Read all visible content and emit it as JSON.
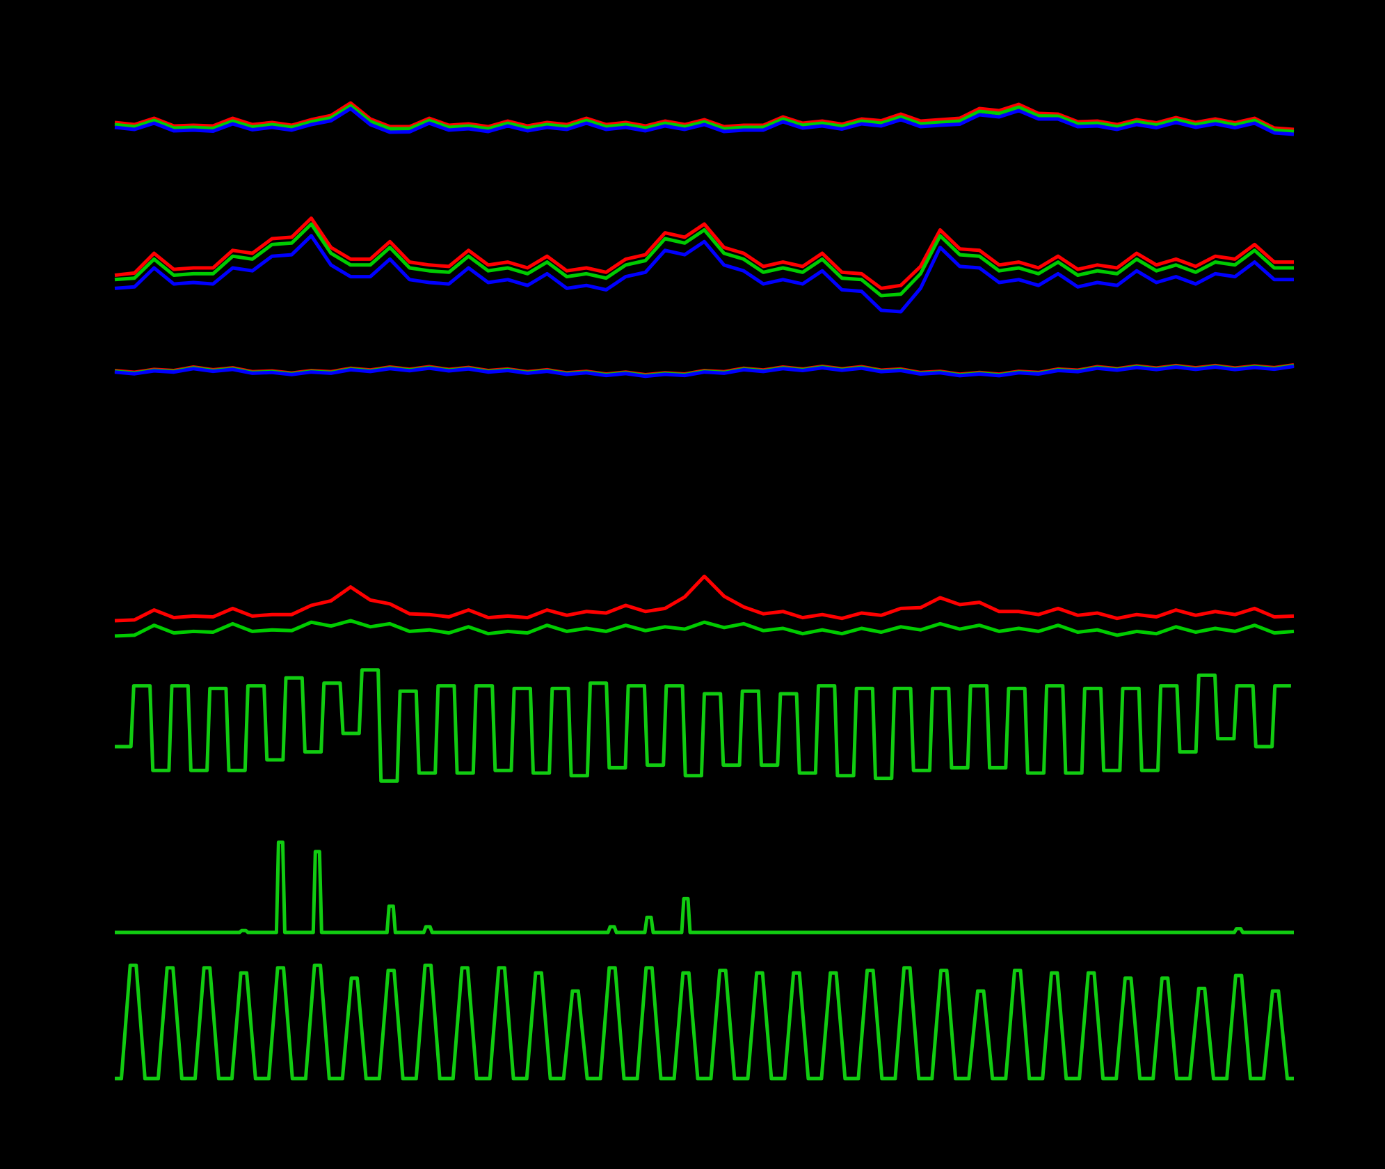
{
  "chart_data": [
    {
      "type": "line",
      "x": {
        "start": 0,
        "step": 1,
        "count": 31
      },
      "ylim": [
        0,
        10
      ],
      "grid": false,
      "legend": "none",
      "series": [
        {
          "color": "#ff0000",
          "values": [
            5.4,
            6.0,
            5.0,
            6.0,
            5.4,
            5.8,
            8.2,
            4.8,
            6.0,
            5.2,
            5.6,
            5.4,
            6.0,
            5.4,
            5.6,
            5.8,
            5.0,
            6.2,
            5.6,
            5.9,
            6.6,
            5.8,
            7.4,
            8.0,
            6.6,
            5.6,
            5.8,
            6.1,
            5.9,
            6.0,
            4.4
          ]
        },
        {
          "color": "#00cc00",
          "values": [
            5.1,
            5.7,
            4.7,
            5.6,
            5.1,
            5.5,
            7.8,
            4.5,
            5.7,
            4.9,
            5.3,
            5.1,
            5.7,
            5.1,
            5.3,
            5.5,
            4.7,
            5.9,
            5.3,
            5.6,
            6.2,
            5.4,
            7.0,
            7.6,
            6.3,
            5.3,
            5.5,
            5.8,
            5.6,
            5.7,
            4.1
          ]
        },
        {
          "color": "#0000ff",
          "values": [
            4.7,
            5.3,
            4.3,
            5.2,
            4.7,
            5.1,
            7.4,
            4.0,
            5.3,
            4.5,
            4.9,
            4.7,
            5.3,
            4.7,
            4.9,
            5.1,
            4.3,
            5.5,
            4.9,
            5.2,
            5.8,
            5.0,
            6.5,
            7.1,
            5.9,
            4.9,
            5.1,
            5.4,
            5.2,
            5.3,
            3.7
          ]
        }
      ]
    },
    {
      "type": "line",
      "x": {
        "start": 0,
        "step": 1,
        "count": 31
      },
      "ylim": [
        0,
        10
      ],
      "grid": false,
      "legend": "none",
      "series": [
        {
          "color": "#ff0000",
          "values": [
            4.5,
            6.0,
            5.0,
            6.2,
            7.0,
            8.4,
            5.6,
            6.8,
            5.2,
            6.2,
            5.4,
            5.8,
            5.0,
            5.6,
            7.4,
            8.0,
            6.0,
            5.4,
            6.0,
            4.6,
            3.8,
            7.6,
            6.2,
            5.4,
            5.8,
            5.2,
            6.0,
            5.6,
            5.8,
            6.6,
            5.4
          ]
        },
        {
          "color": "#00cc00",
          "values": [
            4.2,
            5.6,
            4.6,
            5.8,
            6.6,
            8.0,
            5.2,
            6.4,
            4.8,
            5.8,
            5.0,
            5.4,
            4.6,
            5.2,
            7.0,
            7.6,
            5.6,
            5.0,
            5.6,
            4.2,
            3.2,
            7.2,
            5.8,
            5.0,
            5.4,
            4.8,
            5.6,
            5.2,
            5.4,
            6.2,
            5.0
          ]
        },
        {
          "color": "#0000ff",
          "values": [
            3.6,
            5.0,
            4.0,
            5.0,
            5.8,
            7.2,
            4.4,
            5.6,
            4.0,
            5.0,
            4.2,
            4.6,
            3.8,
            4.4,
            6.2,
            6.8,
            4.8,
            4.2,
            4.8,
            3.4,
            2.0,
            6.4,
            5.0,
            4.2,
            4.6,
            4.0,
            4.8,
            4.4,
            4.6,
            5.4,
            4.2
          ]
        }
      ]
    },
    {
      "type": "line",
      "x": {
        "start": 0,
        "step": 1,
        "count": 31
      },
      "ylim": [
        0,
        10
      ],
      "grid": false,
      "legend": "none",
      "series": [
        {
          "color": "#ff0000",
          "values": [
            5.0,
            5.3,
            5.9,
            5.7,
            4.9,
            5.0,
            5.6,
            5.9,
            6.0,
            5.8,
            5.4,
            5.2,
            4.8,
            4.6,
            4.4,
            5.0,
            5.6,
            5.9,
            6.1,
            6.0,
            5.4,
            4.8,
            4.5,
            4.8,
            5.4,
            6.0,
            6.2,
            6.3,
            6.3,
            6.2,
            6.5
          ]
        },
        {
          "color": "#00cc00",
          "values": [
            4.8,
            5.1,
            5.7,
            5.5,
            4.7,
            4.8,
            5.4,
            5.7,
            5.8,
            5.6,
            5.2,
            5.0,
            4.6,
            4.4,
            4.2,
            4.8,
            5.4,
            5.7,
            5.9,
            5.8,
            5.2,
            4.6,
            4.3,
            4.6,
            5.2,
            5.8,
            6.0,
            6.1,
            6.1,
            6.0,
            6.3
          ]
        },
        {
          "color": "#0000ff",
          "values": [
            4.6,
            4.9,
            5.5,
            5.3,
            4.5,
            4.6,
            5.2,
            5.5,
            5.6,
            5.4,
            5.0,
            4.8,
            4.4,
            4.2,
            4.0,
            4.6,
            5.2,
            5.5,
            5.7,
            5.6,
            5.0,
            4.4,
            4.1,
            4.4,
            5.0,
            5.6,
            5.8,
            5.9,
            5.9,
            5.8,
            6.1
          ]
        }
      ]
    },
    {
      "type": "line",
      "x": {
        "start": 0,
        "step": 1,
        "count": 31
      },
      "ylim": [
        0,
        10
      ],
      "grid": false,
      "legend": "none",
      "series": [
        {
          "color": "#ff0000",
          "values": [
            3.0,
            4.4,
            3.6,
            4.6,
            3.8,
            5.0,
            7.4,
            5.2,
            3.8,
            4.4,
            3.6,
            4.4,
            4.2,
            5.0,
            4.6,
            8.8,
            4.8,
            4.2,
            3.8,
            4.0,
            4.6,
            6.0,
            5.4,
            4.2,
            4.6,
            4.0,
            3.8,
            4.4,
            4.2,
            4.6,
            3.6
          ]
        },
        {
          "color": "#00cc00",
          "values": [
            1.0,
            2.4,
            1.6,
            2.6,
            1.8,
            2.8,
            3.0,
            2.6,
            1.8,
            2.2,
            1.6,
            2.4,
            2.0,
            2.4,
            2.2,
            2.8,
            2.6,
            2.0,
            1.8,
            2.0,
            2.2,
            2.6,
            2.4,
            2.0,
            2.4,
            1.8,
            1.6,
            2.2,
            2.0,
            2.4,
            1.6
          ]
        }
      ]
    },
    {
      "type": "line",
      "x": {
        "start": 0,
        "step": 1,
        "count": 62
      },
      "ylim": [
        0,
        10
      ],
      "grid": false,
      "legend": "none",
      "series": [
        {
          "color": "#11cc11",
          "values": [
            3.0,
            7.6,
            1.2,
            7.6,
            1.2,
            7.4,
            1.2,
            7.6,
            2.0,
            8.2,
            2.6,
            7.8,
            4.0,
            8.8,
            0.4,
            7.2,
            1.0,
            7.6,
            1.0,
            7.6,
            1.2,
            7.4,
            1.0,
            7.4,
            0.8,
            7.8,
            1.4,
            7.6,
            1.6,
            7.6,
            0.8,
            7.0,
            1.6,
            7.2,
            1.6,
            7.0,
            1.0,
            7.6,
            0.8,
            7.4,
            0.6,
            7.4,
            1.2,
            7.4,
            1.4,
            7.6,
            1.4,
            7.4,
            1.0,
            7.6,
            1.0,
            7.4,
            1.2,
            7.4,
            1.2,
            7.6,
            2.6,
            8.4,
            3.6,
            7.6,
            3.0,
            7.6
          ]
        }
      ]
    },
    {
      "type": "bar",
      "x": {
        "start": 0,
        "step": 1,
        "count": 32
      },
      "ylim": [
        0,
        10
      ],
      "grid": false,
      "legend": "none",
      "series": [
        {
          "color": "#11cc11",
          "values": [
            0,
            0,
            0,
            0.2,
            9.6,
            8.6,
            0,
            2.8,
            0.6,
            0,
            0,
            0,
            0,
            0.6,
            1.6,
            3.6,
            0,
            0,
            0,
            0,
            0,
            0,
            0,
            0,
            0,
            0,
            0,
            0,
            0,
            0,
            0.4,
            0
          ]
        }
      ]
    },
    {
      "type": "line",
      "x": {
        "start": 0,
        "step": 1,
        "count": 32
      },
      "ylim": [
        0,
        10
      ],
      "grid": false,
      "legend": "none",
      "series": [
        {
          "color": "#11cc11",
          "values": [
            8.8,
            8.6,
            8.6,
            8.2,
            8.6,
            8.8,
            7.8,
            8.4,
            8.8,
            8.6,
            8.6,
            8.2,
            6.8,
            8.6,
            8.6,
            8.2,
            8.4,
            8.2,
            8.2,
            8.2,
            8.4,
            8.6,
            8.4,
            6.8,
            8.4,
            8.2,
            8.2,
            7.8,
            7.8,
            7.0,
            8.0,
            6.8
          ]
        }
      ]
    }
  ]
}
